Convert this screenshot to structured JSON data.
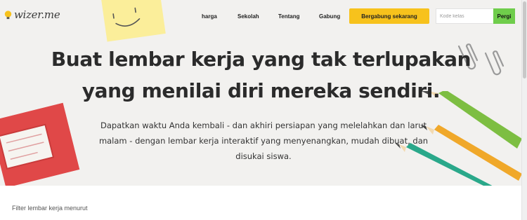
{
  "header": {
    "logo_text": "wizer.me",
    "nav": [
      "harga",
      "Sekolah",
      "Tentang",
      "Gabung"
    ],
    "join_button": "Bergabung sekarang",
    "search_placeholder": "Kode kelas",
    "go_button": "Pergi"
  },
  "hero": {
    "title_line1": "Buat lembar kerja yang tak terlupakan",
    "title_line2": "yang menilai diri mereka sendiri.",
    "subtitle": "Dapatkan waktu Anda kembali - dan akhiri persiapan yang melelahkan dan larut malam - dengan lembar kerja interaktif yang menyenangkan, mudah dibuat, dan disukai siswa."
  },
  "filter": {
    "label": "Filter lembar kerja menurut"
  },
  "colors": {
    "accent_yellow": "#f7c21c",
    "go_green": "#6fcd4b",
    "hero_bg": "#f2f1ef",
    "notebook_red": "#e04848",
    "pencil_green": "#7dbe42",
    "pencil_orange": "#f0a82a",
    "pencil_teal": "#2aa88a"
  },
  "icons": [
    "lightbulb-icon",
    "sticky-note-illustration",
    "paperclip-icon",
    "notebook-illustration",
    "pencil-illustration"
  ]
}
